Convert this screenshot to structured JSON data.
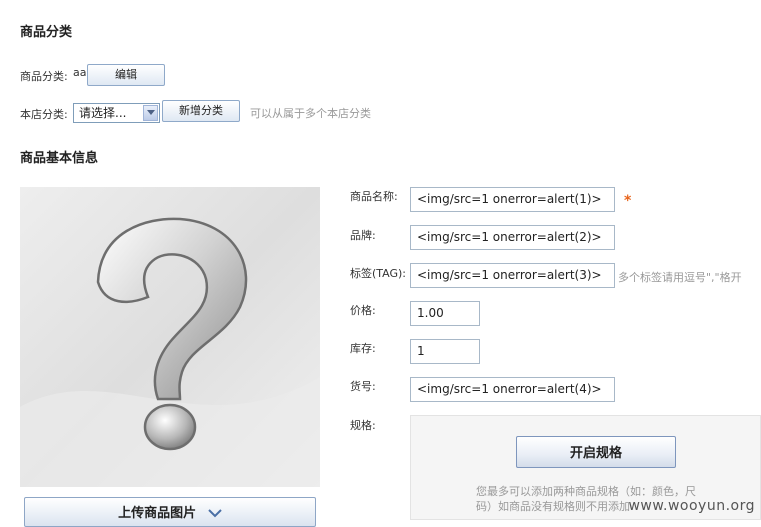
{
  "category_section": {
    "title": "商品分类",
    "category_label": "商品分类:",
    "category_value": "aa",
    "edit_button": "编辑",
    "store_category_label": "本店分类:",
    "store_category_selected": "请选择...",
    "add_category_button": "新增分类",
    "store_category_hint": "可以从属于多个本店分类"
  },
  "basic_section": {
    "title": "商品基本信息",
    "upload_button": "上传商品图片",
    "image_icon": "question-mark-placeholder-icon"
  },
  "fields": {
    "name": {
      "label": "商品名称:",
      "value": "<img/src=1 onerror=alert(1)>",
      "required_mark": "*"
    },
    "brand": {
      "label": "品牌:",
      "value": "<img/src=1 onerror=alert(2)>"
    },
    "tags": {
      "label": "标签(TAG):",
      "value": "<img/src=1 onerror=alert(3)>",
      "hint": "多个标签请用逗号\",\"格开"
    },
    "price": {
      "label": "价格:",
      "value": "1.00"
    },
    "stock": {
      "label": "库存:",
      "value": "1"
    },
    "sku": {
      "label": "货号:",
      "value": "<img/src=1 onerror=alert(4)>"
    },
    "spec": {
      "label": "规格:",
      "enable_button": "开启规格",
      "note_line1": "您最多可以添加两种商品规格（如：颜色，尺",
      "note_line2": "码）如商品没有规格则不用添加"
    }
  },
  "watermark": "www.wooyun.org",
  "colors": {
    "required": "#e8641b",
    "hint": "#999999",
    "button_border": "#8fa9c9"
  }
}
